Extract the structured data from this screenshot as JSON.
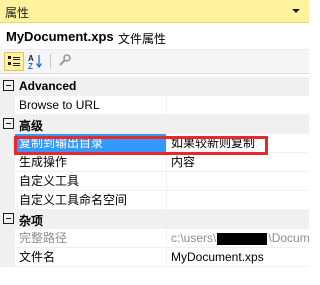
{
  "window": {
    "title": "属性"
  },
  "object_bar": {
    "name": "MyDocument.xps",
    "type": "文件属性"
  },
  "toolbar": {
    "buttons": [
      {
        "icon": "categorized-icon",
        "active": true
      },
      {
        "icon": "alphabetical-icon",
        "active": false
      },
      {
        "icon": "property-pages-wrench-icon",
        "active": false
      }
    ]
  },
  "grid": {
    "categories": [
      {
        "label": "Advanced",
        "properties": [
          {
            "name": "Browse to URL",
            "value": ""
          }
        ]
      },
      {
        "label": "高级",
        "properties": [
          {
            "name": "复制到输出目录",
            "value": "如果较新则复制",
            "selected": true
          },
          {
            "name": "生成操作",
            "value": "内容"
          },
          {
            "name": "自定义工具",
            "value": ""
          },
          {
            "name": "自定义工具命名空间",
            "value": ""
          }
        ]
      },
      {
        "label": "杂项",
        "properties": [
          {
            "name": "完整路径",
            "value_prefix": "c:\\users\\",
            "value_suffix": "\\Docume",
            "disabled": true
          },
          {
            "name": "文件名",
            "value": "MyDocument.xps"
          }
        ]
      }
    ]
  },
  "colors": {
    "title_background": "#fff29d",
    "selection": "#3399ff",
    "highlight_box": "#e8282a"
  }
}
